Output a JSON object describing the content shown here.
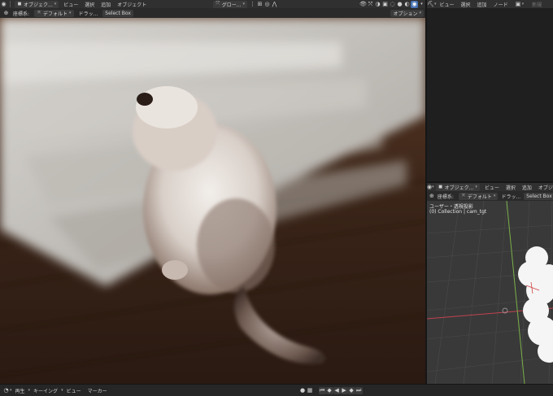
{
  "topbar": {
    "mode_label": "オブジェク...",
    "menus": [
      "ビュー",
      "選択",
      "追加",
      "オブジェクト"
    ],
    "orientation_label": "グロー..."
  },
  "main_header": {
    "orientation_label": "座標系:",
    "orientation_value": "デフォルト",
    "drag_label": "ドラッ...",
    "select_value": "Select Box",
    "options_label": "オプション"
  },
  "right_top_editor": {
    "menus": [
      "ビュー",
      "選択",
      "追加",
      "ノード"
    ],
    "new_label": "新規"
  },
  "right_bottom_editor": {
    "mode_label": "オブジェク...",
    "menus": [
      "ビュー",
      "選択",
      "追加",
      "オブジェクト"
    ],
    "orientation_label": "座標系:",
    "orientation_value": "デフォルト",
    "drag_label": "ドラッ...",
    "select_value": "Select Box",
    "view_title": "ユーザー・透視投影",
    "view_subtitle": "(0) Collection | cam_tgt"
  },
  "timeline": {
    "playback_label": "再生",
    "keying_label": "キーイング",
    "view_label": "ビュー",
    "marker_label": "マーカー"
  },
  "colors": {
    "accent": "#4772b3",
    "axis_x": "#c0434f",
    "axis_y": "#7ab04a",
    "record": "#d0d0d0"
  },
  "icons": {
    "editor_type": "3d-viewport-icon",
    "select_box": "select-box-icon",
    "play": "play-icon",
    "record": "record-icon"
  }
}
